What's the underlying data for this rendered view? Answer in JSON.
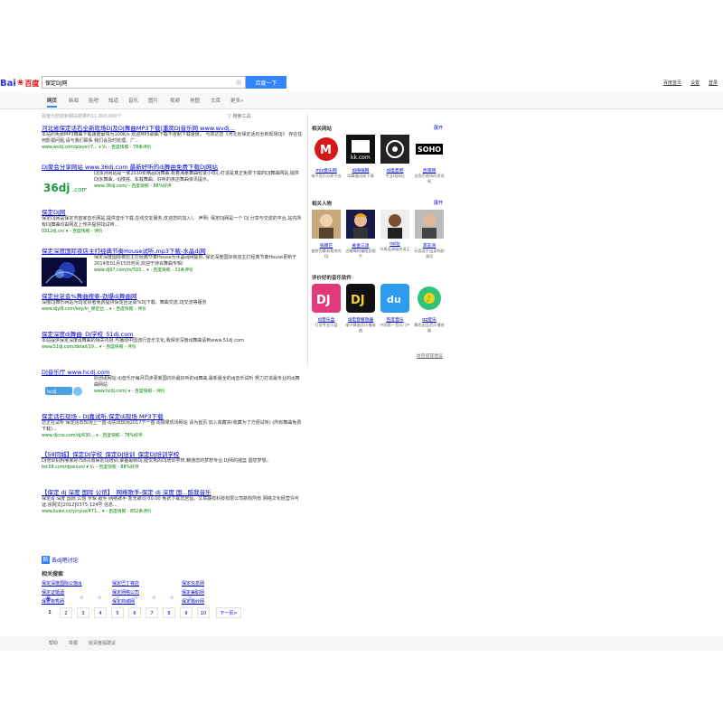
{
  "header": {
    "logo_text": "Bai",
    "logo_du": "百度",
    "search_value": "保定DJ网",
    "search_button": "百度一下",
    "top_links": [
      "百度首页",
      "设置",
      "登录"
    ]
  },
  "tabs": [
    "网页",
    "新闻",
    "贴吧",
    "知道",
    "音乐",
    "图片",
    "视频",
    "地图",
    "文库",
    "更多»"
  ],
  "result_count": "百度为您找到相关结果约11,000,000个",
  "search_tools": "搜索工具",
  "results": [
    {
      "title": "河北省保定话石全新现场DJ及DJ舞曲MP3下载|潘凤DJ音乐网 www.wvdj...",
      "desc": "本站的免费MP3舞曲下载速度最快为100K/s 欢迎MP3歌曲下载不限制下载速度。 与高达音《河北省保定话石全新现场DJ》 存在任何影视问题,请与我们联系 我们会及时处理。广...",
      "url": "www.wvdj.com/player/7... ▾ V₁ - 百度快照 - 78条评价"
    },
    {
      "title": "DJ聚会分享网站 www.36dj.com 最新好听的dj舞曲免费下载DJ网站",
      "desc": "DJ派对网站是一家2010年精品DJ舞曲,有着海量舞曲收录小样心打造是真正免费下载的DJ舞曲网站,提供DJ永舞曲、dj慢摇、车载舞曲、好听的夜店舞曲资讯提示。",
      "url": "www.36dj.com/ - 百度快照 - 88%好评"
    },
    {
      "title": "保定DJ网",
      "desc": "保定DJ网是保定市首家音乐网站,提供音乐下载,在线交友服务,欢迎您的加入!。 声明: 保定DJ网是一个 DJ 分享与交流的平台,站内所有DJ舞曲均由网友上传并提供DJ试听...",
      "url": "0312dj.cn/ ▾ - 百度快照 - 评价"
    },
    {
      "title": "保定深度国际夜店主打经典节奏House试听,mp3下载-水晶dj网",
      "desc": "保定深度国际夜店主打经典节奏House为水晶dj网提供, 保定深度国际夜店主打经典节奏House更新于2014年01月15日时间,欢迎于持会舞曲专辑!",
      "url": "www.dj97.com/m/593... ▾ - 百度快照 - 32条评价"
    },
    {
      "title": "保定丝足会%舞曲搜索-劲爆dj舞曲网",
      "desc": "深度DJ舞乐网站为DJ爱好者免费提供保定丝足会%DJ下载、舞曲交流,DJ交流等服务",
      "url": "www.djyl8.com/key/in_保定丝... ▾ - 百度快照 - 评价"
    },
    {
      "title": "保定深度dj舞曲_DJ学校_51dj.com",
      "desc": "本站提供保定深度dj舞曲的相关内容,与播动中国流行音乐文化,我保定深度dj舞曲请到www.51dj.com",
      "url": "www.51dj.com/detail/19... ▾ - 百度快照 - 评价"
    },
    {
      "title": "DJ音乐厅 www.hcdj.com",
      "desc": "原创dj网站 dj音乐厅每月同步更新国内外最好听的dj舞曲,最新最全的dj音乐试听 努力打造最专业的dj舞曲网站",
      "url": "www.hcdj.com/ ▾ - 百度快照 - 评价"
    },
    {
      "title": "保定话石现场 - DJ嘉试听,保定dj现场 MP3下载",
      "desc": "您正在试听 保定话石现场上一首 dj先出现场2017下一首 dj城果现场网站 请为首页 加入收藏夹(收藏为了方便试听) (所有舞曲免费下载)...",
      "url": "www.djcoo.com/dj/630... ▾ - 百度快照 - 78%好评"
    },
    {
      "title": "【58同城】保定DJ学校_保定DJ培训_保定DJ培训学校",
      "desc": "DJ培训机构哪家好?58同城保定DJ培训,掌握最新DJ,能优秀的DJ培训学校,精通您的梦想专业,DJ师的摇篮 圆您梦想。",
      "url": "bd.58.com/dpeixun/ ▾ V₁ - 百度快照 - 88%好评"
    },
    {
      "title": "【保定 dj 深度 国际 公馆】_网络歌手-保定 dj 深度 国...酷我音乐",
      "desc": "保定dj 深度 国际 公馆 专辑 歌手 网络歌手 暂无歌词 00:00 免费下载您居留。文章翻有科技有限公司新权所有 网络文化经营许可证:京网文[2012]0375-124号 信息...",
      "url": "www.kuwo.cn/yinyue/471... ▾ - 百度快照 - 852条评价"
    }
  ],
  "right": {
    "site_title": "相关网站",
    "expand": "展开",
    "sites": [
      {
        "name": "mix音乐网",
        "sub": "电子音乐分享平台"
      },
      {
        "name": "dj嗨嗨网",
        "sub": "DJ舞曲试听下载"
      },
      {
        "name": "dj电音吧",
        "sub": "专业DJ网站"
      },
      {
        "name": "舌夜网",
        "sub": "全国舌夜场所资讯网"
      }
    ],
    "people_title": "相关人物",
    "people": [
      {
        "name": "张颖芒",
        "sub": "被称为最有票房的DJ"
      },
      {
        "name": "关金三洋",
        "sub": "过硬嗓的耀眼女歌手"
      },
      {
        "name": "nelly",
        "sub": "节奏蓝调维欢说王"
      },
      {
        "name": "李志洲",
        "sub": "元类选手出身戏剧演员"
      }
    ],
    "apps_title": "评价好的音乐软件",
    "apps": [
      {
        "name": "dj音乐盒",
        "sub": "打造专业乐盘",
        "label": "DJ"
      },
      {
        "name": "dj电音播放器",
        "sub": "电子舞曲音乐播放器",
        "label": "DJ"
      },
      {
        "name": "百度音乐",
        "sub": "中国第一音乐门户",
        "label": "du"
      },
      {
        "name": "qq音乐",
        "sub": "腾讯出品音乐播放器",
        "label": "♪"
      }
    ],
    "feedback": "给百度提建议"
  },
  "tieba": "去dj吧讨论",
  "related_title": "相关搜索",
  "related": [
    "保定深度国际公馆dj",
    "保定巴丁夜店",
    "保定信息网",
    "保定证婚酒",
    "保定网络公司",
    "保定兼职网",
    "保定夜秀网",
    "保定商城网",
    "保定婚纱网"
  ],
  "pages": [
    "1",
    "2",
    "3",
    "4",
    "5",
    "6",
    "7",
    "8",
    "9",
    "10",
    "下一页>"
  ],
  "footer": [
    "帮助",
    "举报",
    "给百度提建议"
  ],
  "colors": {
    "accent": "#3385ff",
    "link": "#0000cc",
    "highlight": "#cc0000",
    "url": "#008000"
  }
}
